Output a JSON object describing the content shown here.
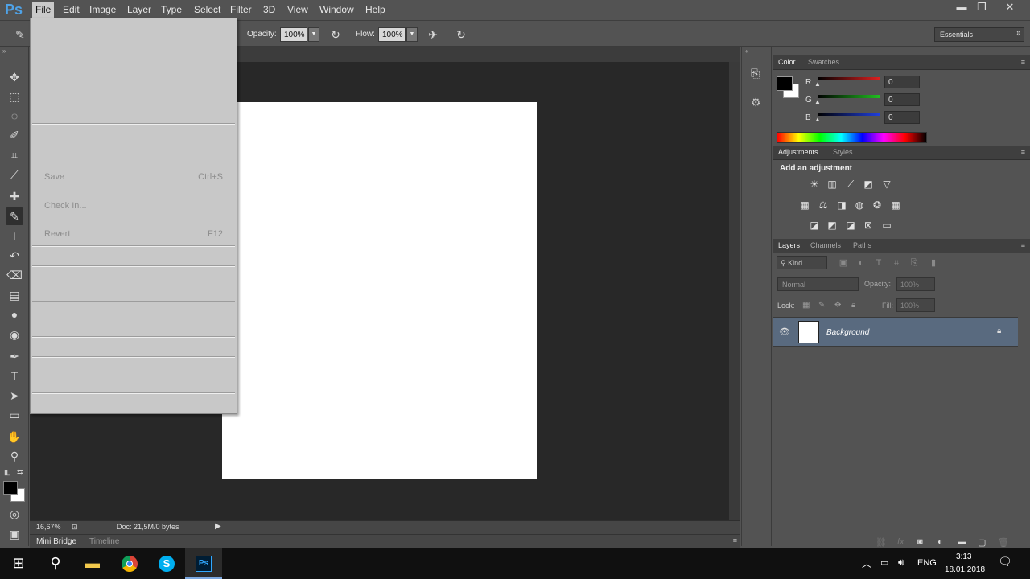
{
  "app": {
    "logo": "Ps"
  },
  "menubar": {
    "items": [
      "File",
      "Edit",
      "Image",
      "Layer",
      "Type",
      "Select",
      "Filter",
      "3D",
      "View",
      "Window",
      "Help"
    ]
  },
  "window_controls": {
    "minimize": "▬",
    "restore": "❐",
    "close": "✕"
  },
  "options": {
    "opacity_label": "Opacity:",
    "opacity_value": "100%",
    "flow_label": "Flow:",
    "flow_value": "100%",
    "workspace": "Essentials"
  },
  "file_menu": {
    "items": [
      {
        "label": "Save",
        "shortcut": "Ctrl+S"
      },
      {
        "label": "Check In...",
        "shortcut": ""
      },
      {
        "label": "Revert",
        "shortcut": "F12"
      }
    ]
  },
  "status": {
    "zoom": "16,67%",
    "doc": "Doc: 21,5M/0 bytes"
  },
  "bottom_tabs": {
    "mini_bridge": "Mini Bridge",
    "timeline": "Timeline"
  },
  "color_panel": {
    "tabs": [
      "Color",
      "Swatches"
    ],
    "channels": [
      {
        "label": "R",
        "value": "0",
        "color": "#e02020"
      },
      {
        "label": "G",
        "value": "0",
        "color": "#20c020"
      },
      {
        "label": "B",
        "value": "0",
        "color": "#2040e0"
      }
    ]
  },
  "adjustments_panel": {
    "tabs": [
      "Adjustments",
      "Styles"
    ],
    "heading": "Add an adjustment"
  },
  "layers_panel": {
    "tabs": [
      "Layers",
      "Channels",
      "Paths"
    ],
    "filter_kind": "Kind",
    "blend_mode": "Normal",
    "opacity_label": "Opacity:",
    "opacity_value": "100%",
    "lock_label": "Lock:",
    "fill_label": "Fill:",
    "fill_value": "100%",
    "layers": [
      {
        "name": "Background"
      }
    ]
  },
  "taskbar": {
    "language": "ENG",
    "time": "3:13",
    "date": "18.01.2018"
  },
  "colors": {
    "accent": "#4fa3e8",
    "selected_layer": "#596a7f"
  }
}
